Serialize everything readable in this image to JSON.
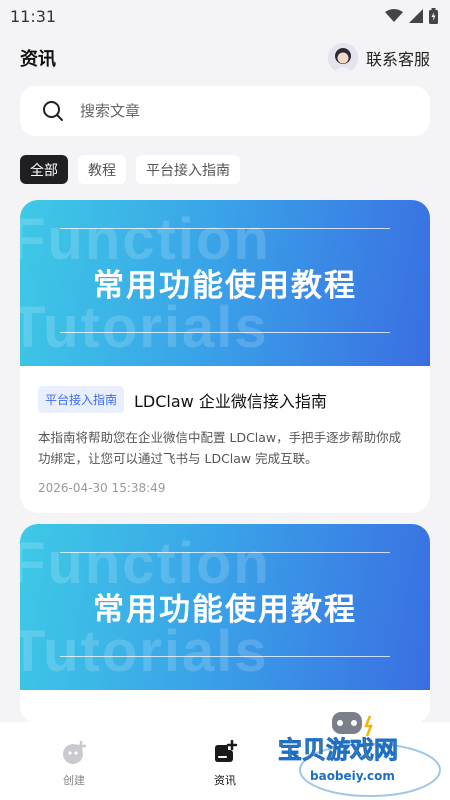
{
  "status_bar": {
    "time": "11:31"
  },
  "header": {
    "title": "资讯",
    "support_label": "联系客服"
  },
  "search": {
    "placeholder": "搜索文章"
  },
  "tabs": [
    {
      "label": "全部",
      "active": true
    },
    {
      "label": "教程",
      "active": false
    },
    {
      "label": "平台接入指南",
      "active": false
    }
  ],
  "articles": [
    {
      "banner_title": "常用功能使用教程",
      "banner_bg_text_1": "Function",
      "banner_bg_text_2": "Tutorials",
      "badge": "平台接入指南",
      "title": "LDClaw 企业微信接入指南",
      "summary": "本指南将帮助您在企业微信中配置 LDClaw，手把手逐步帮助你成功绑定，让您可以通过飞书与 LDClaw 完成互联。",
      "date": "2026-04-30 15:38:49"
    },
    {
      "banner_title": "常用功能使用教程",
      "banner_bg_text_1": "Function",
      "banner_bg_text_2": "Tutorials"
    }
  ],
  "bottom_nav": [
    {
      "label": "创建",
      "icon": "create-icon",
      "active": false
    },
    {
      "label": "资讯",
      "icon": "news-icon",
      "active": true
    }
  ],
  "watermark": {
    "text": "宝贝游戏网",
    "url_text": "baobeiy.com"
  },
  "colors": {
    "accent": "#3b6cf5",
    "tab_active": "#1f1f22",
    "banner_start": "#3ec9e6",
    "banner_end": "#3a6ee2"
  }
}
